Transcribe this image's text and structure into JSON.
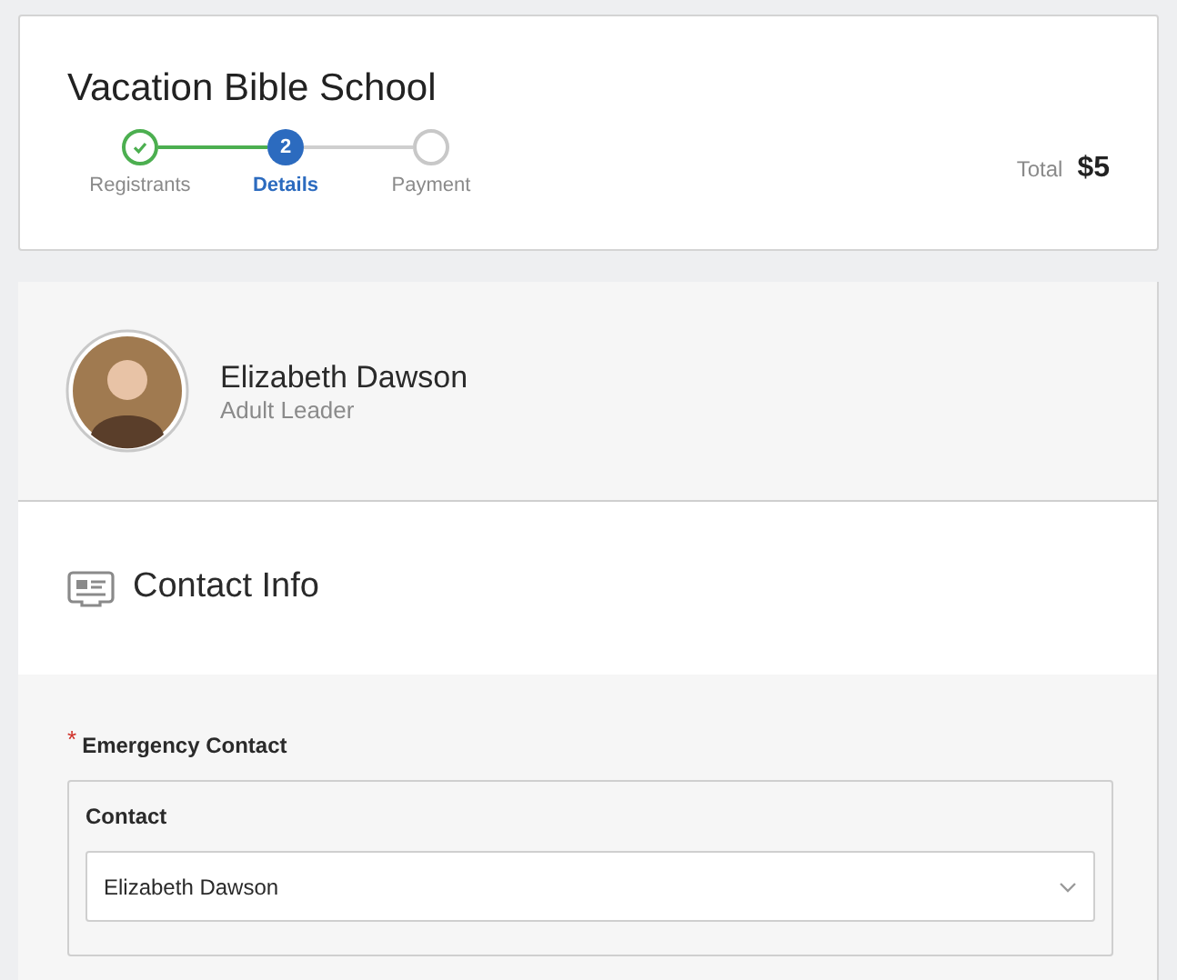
{
  "header": {
    "title": "Vacation Bible School",
    "steps": [
      {
        "label": "Registrants",
        "kind": "complete"
      },
      {
        "label": "Details",
        "kind": "current",
        "number": "2"
      },
      {
        "label": "Payment",
        "kind": "upcoming"
      }
    ],
    "total_label": "Total",
    "total_value": "$5"
  },
  "person": {
    "name": "Elizabeth Dawson",
    "role": "Adult Leader"
  },
  "section": {
    "title": "Contact Info"
  },
  "field": {
    "label": "Emergency Contact",
    "required_mark": "*",
    "group_label": "Contact",
    "value": "Elizabeth Dawson"
  }
}
